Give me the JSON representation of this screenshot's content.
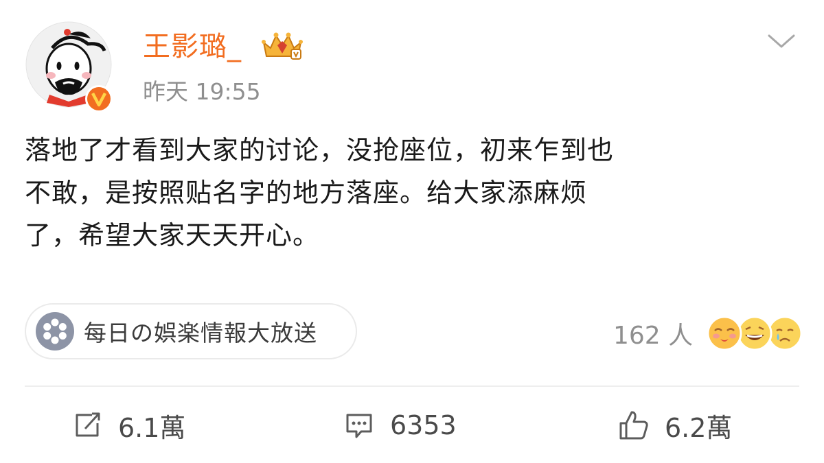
{
  "post": {
    "author": {
      "name": "王影璐_",
      "timestamp": "昨天 19:55"
    },
    "text_lines": [
      "落地了才看到大家的讨论，没抢座位，初来乍到也",
      "不敢，是按照贴名字的地方落座。给大家添麻烦",
      "了，希望大家天天开心。"
    ],
    "topic": {
      "label": "每日の娯楽情報大放送",
      "icon": "topic-flower-icon"
    },
    "reactions": {
      "count_label": "162 人",
      "emojis": [
        "kiss-face-icon",
        "laughing-face-icon",
        "crying-face-icon"
      ]
    },
    "actions": {
      "repost": {
        "label": "6.1萬",
        "icon": "repost-icon"
      },
      "comment": {
        "label": "6353",
        "icon": "comment-icon"
      },
      "like": {
        "label": "6.2萬",
        "icon": "thumbs-up-icon"
      }
    }
  },
  "colors": {
    "username": "#f26d20",
    "secondary_text": "#8f8f8f",
    "verified_badge": "#f26d20"
  }
}
